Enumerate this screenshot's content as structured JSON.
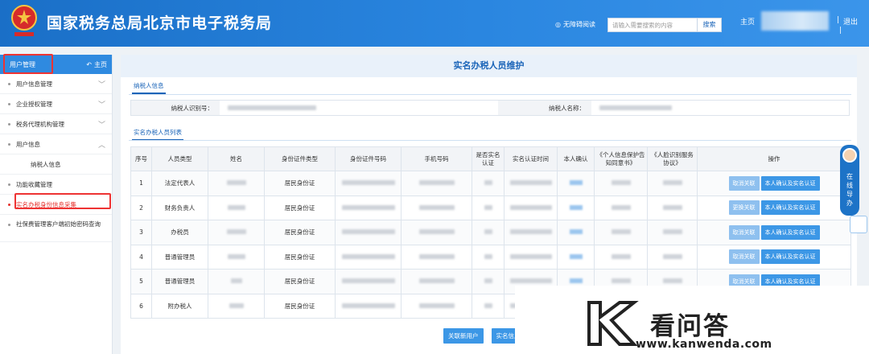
{
  "header": {
    "site_title": "国家税务总局北京市电子税务局",
    "accessibility": "无障碍阅读",
    "search_placeholder": "请输入需要搜索的内容",
    "search_button": "搜索",
    "home": "主页",
    "separator": "|",
    "logout": "退出",
    "brand_color": "#2a86e0"
  },
  "sidebar": {
    "section_title": "用户管理",
    "home_link": "主页",
    "items": [
      {
        "label": "用户信息管理"
      },
      {
        "label": "企业授权管理"
      },
      {
        "label": "税务代理机构管理"
      },
      {
        "label": "用户信息"
      },
      {
        "label": "纳税人信息"
      },
      {
        "label": "功能收藏管理"
      },
      {
        "label": "实名办税身份信息采集"
      },
      {
        "label": "社保费管理客户端初始密码查询"
      }
    ]
  },
  "panel": {
    "title": "实名办税人员维护",
    "tab_info": "纳税人信息",
    "taxpayer_id_label": "纳税人识别号：",
    "taxpayer_name_label": "纳税人名称：",
    "tab_list": "实名办税人员列表"
  },
  "table": {
    "headers": [
      "序号",
      "人员类型",
      "姓名",
      "身份证件类型",
      "身份证件号码",
      "手机号码",
      "是否实名认证",
      "实名认证时间",
      "本人确认",
      "《个人信息保护告知同意书》",
      "《人脸识别服务协议》",
      "操作"
    ],
    "rows": [
      {
        "no": "1",
        "type": "法定代表人",
        "id_type": "居民身份证",
        "btn1": "取消关联",
        "btn2": "本人确认及实名认证"
      },
      {
        "no": "2",
        "type": "财务负责人",
        "id_type": "居民身份证",
        "btn1": "更换关联",
        "btn2": "本人确认及实名认证"
      },
      {
        "no": "3",
        "type": "办税员",
        "id_type": "居民身份证",
        "btn1": "取消关联",
        "btn2": "本人确认及实名认证"
      },
      {
        "no": "4",
        "type": "普通管理员",
        "id_type": "居民身份证",
        "btn1": "取消关联",
        "btn2": "本人确认及实名认证"
      },
      {
        "no": "5",
        "type": "普通管理员",
        "id_type": "居民身份证",
        "btn1": "取消关联",
        "btn2": "本人确认及实名认证"
      },
      {
        "no": "6",
        "type": "附办税人",
        "id_type": "居民身份证",
        "btn1": "",
        "btn2": ""
      }
    ]
  },
  "bottom": {
    "link_new_user": "关联新用户",
    "realname_info": "实名信息"
  },
  "float": {
    "guide": "在线导办"
  },
  "watermark": {
    "title": "看问答",
    "url": "www.kanwenda.com"
  }
}
